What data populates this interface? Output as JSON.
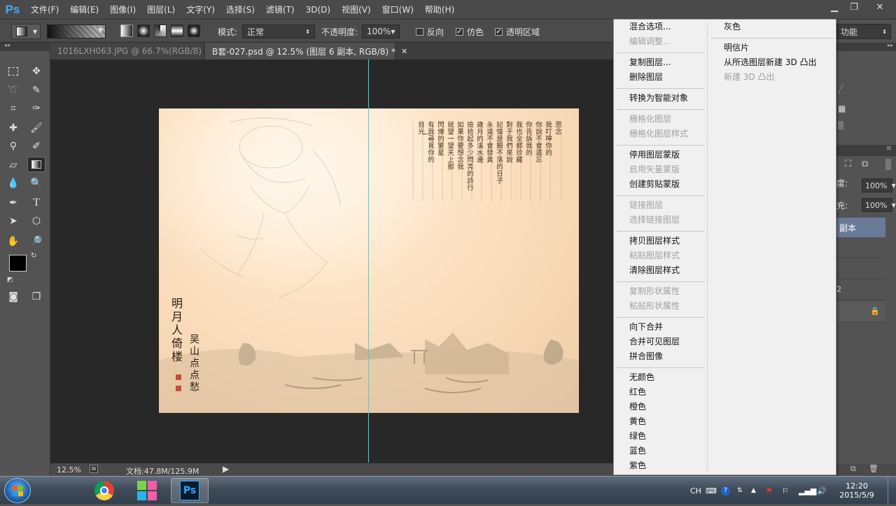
{
  "app": {
    "logo": "Ps"
  },
  "menubar": {
    "items": [
      "文件(F)",
      "编辑(E)",
      "图像(I)",
      "图层(L)",
      "文字(Y)",
      "选择(S)",
      "滤镜(T)",
      "3D(D)",
      "视图(V)",
      "窗口(W)",
      "帮助(H)"
    ],
    "window_controls": [
      "minimize",
      "restore",
      "close"
    ]
  },
  "options_bar": {
    "mode_label": "模式:",
    "mode_value": "正常",
    "opacity_label": "不透明度:",
    "opacity_value": "100%",
    "reverse_label": "反向",
    "dither_label": "仿色",
    "transparency_label": "透明区域",
    "reverse_checked": false,
    "dither_checked": true,
    "transparency_checked": true,
    "workspace_select": "功能"
  },
  "tabs": [
    {
      "label": "1016LXH063.JPG @ 66.7%(RGB/8)",
      "active": false
    },
    {
      "label": "B套-027.psd @ 12.5% (图层 6 副本, RGB/8) *",
      "active": true
    }
  ],
  "canvas": {
    "signature_text": "明月人倚楼",
    "artist_text": "吴山点点愁",
    "poem_columns": [
      "思念",
      "我叮嚀你的",
      "你說不會遺忘",
      "你告訴我的",
      "我也全都珍藏",
      "對于我們來說",
      "記憶是顆不落的日子",
      "永遠不會發黃",
      "歲月的溪水邊",
      "撿拾起多少閃亮的詩行",
      "如果你要想念我",
      "就望一望天上那",
      "閃爍的繁星",
      "有我尋覓你的",
      "目光"
    ],
    "poem_divider": "一"
  },
  "statusbar": {
    "zoom": "12.5%",
    "doc_info": "文档:47.8M/125.9M"
  },
  "right_panel": {
    "opacity_label": "度:",
    "opacity_value": "100%",
    "fill_label": "充:",
    "fill_value": "100%",
    "layer_label": "副本",
    "layer_number": "2"
  },
  "context_menu": {
    "col1": [
      {
        "label": "混合选项...",
        "enabled": true
      },
      {
        "label": "编辑调整...",
        "enabled": false
      },
      {
        "sep": true
      },
      {
        "label": "复制图层...",
        "enabled": true
      },
      {
        "label": "删除图层",
        "enabled": true
      },
      {
        "sep": true
      },
      {
        "label": "转换为智能对象",
        "enabled": true
      },
      {
        "sep": true
      },
      {
        "label": "栅格化图层",
        "enabled": false
      },
      {
        "label": "栅格化图层样式",
        "enabled": false
      },
      {
        "sep": true
      },
      {
        "label": "停用图层蒙版",
        "enabled": true
      },
      {
        "label": "启用矢量蒙版",
        "enabled": false
      },
      {
        "label": "创建剪贴蒙版",
        "enabled": true
      },
      {
        "sep": true
      },
      {
        "label": "链接图层",
        "enabled": false
      },
      {
        "label": "选择链接图层",
        "enabled": false
      },
      {
        "sep": true
      },
      {
        "label": "拷贝图层样式",
        "enabled": true
      },
      {
        "label": "粘贴图层样式",
        "enabled": false
      },
      {
        "label": "清除图层样式",
        "enabled": true
      },
      {
        "sep": true
      },
      {
        "label": "复制形状属性",
        "enabled": false
      },
      {
        "label": "粘贴形状属性",
        "enabled": false
      },
      {
        "sep": true
      },
      {
        "label": "向下合并",
        "enabled": true
      },
      {
        "label": "合并可见图层",
        "enabled": true
      },
      {
        "label": "拼合图像",
        "enabled": true
      },
      {
        "sep": true
      },
      {
        "label": "无颜色",
        "enabled": true
      },
      {
        "label": "红色",
        "enabled": true
      },
      {
        "label": "橙色",
        "enabled": true
      },
      {
        "label": "黄色",
        "enabled": true
      },
      {
        "label": "绿色",
        "enabled": true
      },
      {
        "label": "蓝色",
        "enabled": true
      },
      {
        "label": "紫色",
        "enabled": true
      }
    ],
    "col2": [
      {
        "label": "灰色",
        "enabled": true
      },
      {
        "sep": true
      },
      {
        "label": "明信片",
        "enabled": true
      },
      {
        "label": "从所选图层新建 3D 凸出",
        "enabled": true
      },
      {
        "label": "新建 3D 凸出",
        "enabled": false
      }
    ]
  },
  "taskbar": {
    "apps": [
      "chrome-icon",
      "app-icon",
      "photoshop-icon"
    ],
    "photoshop_label": "Ps",
    "lang": "CH",
    "time": "12:20",
    "date": "2015/5/9"
  },
  "colors": {
    "ui_dark": "#535353",
    "workspace": "#282828",
    "canvas_paper": "#fde4c6",
    "guide": "#3fd4d8",
    "menu_bg": "#f0f0f0",
    "ps_blue": "#4aa9f0",
    "foreground_color": "#000000",
    "background_color": "#ffffff"
  }
}
